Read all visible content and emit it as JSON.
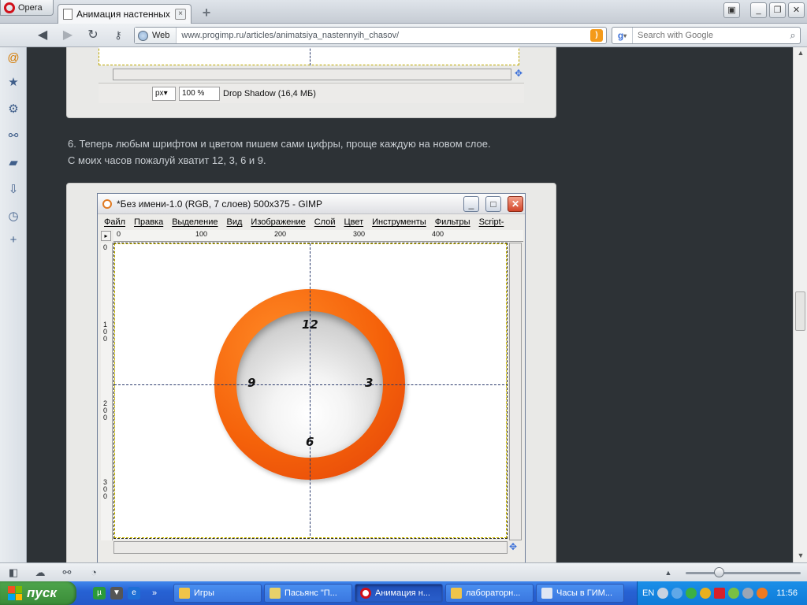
{
  "browser": {
    "menu_label": "Opera",
    "tab_title": "Анимация настенных ча",
    "new_tab": "+",
    "address_label": "Web",
    "url": "www.progimp.ru/articles/animatsiya_nastennyih_chasov/",
    "search_placeholder": "Search with Google"
  },
  "article": {
    "line1": "6. Теперь любым шрифтом и цветом пишем сами цифры, проще каждую на новом слое.",
    "line2": "С моих часов пожалуй хватит 12, 3, 6 и 9."
  },
  "gimp_top": {
    "unit": "px",
    "zoom": "100 %",
    "status": "Drop Shadow (16,4 МБ)"
  },
  "gimp": {
    "title": "*Без имени-1.0 (RGB, 7 слоев) 500x375 - GIMP",
    "menu": [
      "Файл",
      "Правка",
      "Выделение",
      "Вид",
      "Изображение",
      "Слой",
      "Цвет",
      "Инструменты",
      "Фильтры",
      "Script-"
    ],
    "ruler_top": [
      "0",
      "100",
      "200",
      "300",
      "400"
    ],
    "ruler_left": [
      "0",
      "1\n0\n0",
      "2\n0\n0",
      "3\n0\n0"
    ],
    "clock_numbers": {
      "n12": "12",
      "n3": "3",
      "n6": "6",
      "n9": "9"
    }
  },
  "colors": {
    "ring": "#f5620a",
    "page_bg": "#2d3236",
    "taskbar": "#2762d4"
  },
  "taskbar": {
    "start": "пуск",
    "tasks": [
      "Игры",
      "Пасьянс \"П...",
      "Анимация н...",
      "лабораторн...",
      "Часы в ГИМ..."
    ],
    "lang": "EN",
    "time": "11:56"
  }
}
